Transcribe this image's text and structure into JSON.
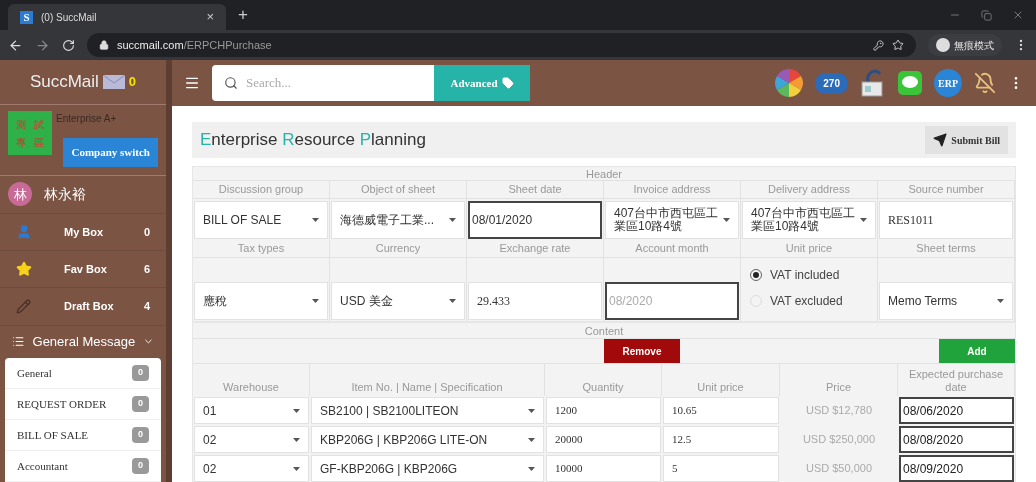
{
  "browser": {
    "tab": {
      "favicon": "S",
      "title": "(0) SuccMail",
      "close": "×"
    },
    "new_tab": "+",
    "address": {
      "domain": "succmail.com",
      "path": "/ERPCHPurchase"
    },
    "profile": "無痕模式"
  },
  "app": {
    "logo": "SuccMail",
    "unread": "0",
    "search": {
      "placeholder": "Search..."
    },
    "advanced": "Advanced",
    "cloud_count": "270",
    "erp": "ERP"
  },
  "sidebar": {
    "company": {
      "logo_chars": [
        "測",
        "試",
        "專",
        "區"
      ],
      "plan": "Enterprise A+",
      "switch": "Company switch"
    },
    "user": {
      "initial": "林",
      "name": "林永裕"
    },
    "boxes": [
      {
        "kind": "person",
        "label": "My Box",
        "count": "0"
      },
      {
        "kind": "star",
        "label": "Fav Box",
        "count": "6"
      },
      {
        "kind": "pencil",
        "label": "Draft Box",
        "count": "4"
      }
    ],
    "group": {
      "title": "General Message",
      "expanded": true,
      "items": [
        {
          "label": "General",
          "count": "0"
        },
        {
          "label": "REQUEST ORDER",
          "count": "0"
        },
        {
          "label": "BILL OF SALE",
          "count": "0"
        },
        {
          "label": "Accountant",
          "count": "0"
        }
      ]
    }
  },
  "page": {
    "title_words": [
      "Enterprise",
      "Resource",
      "Planning"
    ],
    "submit": "Submit Bill"
  },
  "header": {
    "title": "Header",
    "fields": [
      {
        "label": "Discussion group",
        "kind": "select",
        "value": "BILL OF SALE"
      },
      {
        "label": "Object of sheet",
        "kind": "select",
        "value": "海德威電子工業..."
      },
      {
        "label": "Sheet date",
        "kind": "date",
        "value": "08/01/2020"
      },
      {
        "label": "Invoice address",
        "kind": "select",
        "value": "407台中市西屯區工業區10路4號"
      },
      {
        "label": "Delivery address",
        "kind": "select",
        "value": "407台中市西屯區工業區10路4號"
      },
      {
        "label": "Source number",
        "kind": "input",
        "value": "RES1011"
      },
      {
        "label": "Tax types",
        "kind": "select",
        "value": "應稅"
      },
      {
        "label": "Currency",
        "kind": "select",
        "value": "USD 美金"
      },
      {
        "label": "Exchange rate",
        "kind": "input",
        "value": "29.433"
      },
      {
        "label": "Account month",
        "kind": "month",
        "placeholder": "08/2020"
      },
      {
        "label": "Unit price",
        "kind": "radio",
        "options": [
          {
            "label": "VAT included",
            "selected": true
          },
          {
            "label": "VAT excluded",
            "selected": false
          }
        ]
      },
      {
        "label": "Sheet terms",
        "kind": "select",
        "value": "Memo Terms"
      }
    ]
  },
  "content": {
    "title": "Content",
    "remove": "Remove",
    "add": "Add",
    "columns": [
      "Warehouse",
      "Item No. | Name | Specification",
      "Quantity",
      "Unit price",
      "Price",
      "Expected purchase date"
    ],
    "rows": [
      {
        "warehouse": "01",
        "item": "SB2100 | SB2100LITEON",
        "quantity": "1200",
        "unit_price": "10.65",
        "price": "USD $12,780",
        "date": "08/06/2020"
      },
      {
        "warehouse": "02",
        "item": "KBP206G | KBP206G LITE-ON",
        "quantity": "20000",
        "unit_price": "12.5",
        "price": "USD $250,000",
        "date": "08/08/2020"
      },
      {
        "warehouse": "02",
        "item": "GF-KBP206G | KBP206G",
        "quantity": "10000",
        "unit_price": "5",
        "price": "USD $50,000",
        "date": "08/09/2020"
      }
    ]
  }
}
